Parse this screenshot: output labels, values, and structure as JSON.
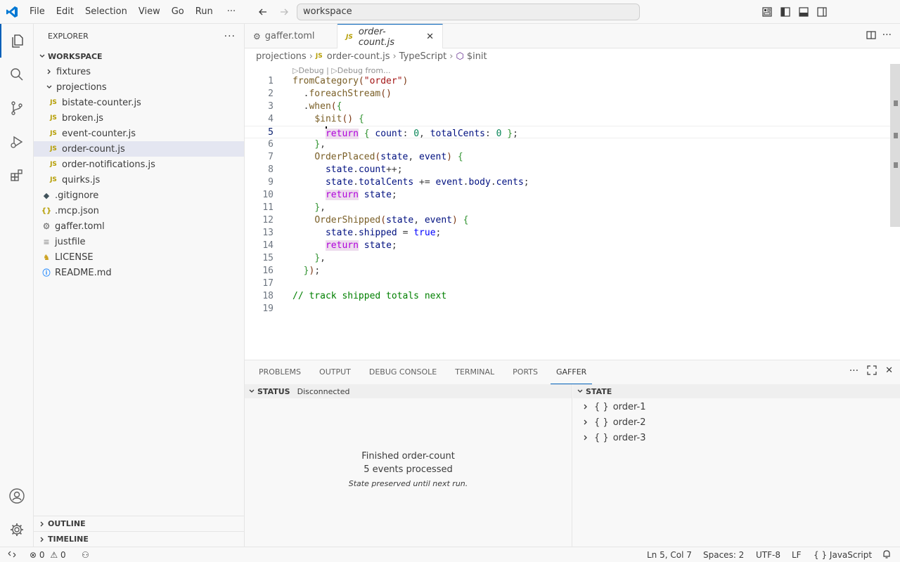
{
  "menu": [
    "File",
    "Edit",
    "Selection",
    "View",
    "Go",
    "Run",
    "···"
  ],
  "command_center": "workspace",
  "sidebar": {
    "title": "EXPLORER",
    "root": "WORKSPACE",
    "items": [
      {
        "label": "fixtures",
        "type": "folder"
      },
      {
        "label": "projections",
        "type": "folder-open"
      },
      {
        "label": "bistate-counter.js",
        "type": "js"
      },
      {
        "label": "broken.js",
        "type": "js"
      },
      {
        "label": "event-counter.js",
        "type": "js"
      },
      {
        "label": "order-count.js",
        "type": "js"
      },
      {
        "label": "order-notifications.js",
        "type": "js"
      },
      {
        "label": "quirks.js",
        "type": "js"
      },
      {
        "label": ".gitignore",
        "type": "git"
      },
      {
        "label": ".mcp.json",
        "type": "json"
      },
      {
        "label": "gaffer.toml",
        "type": "toml"
      },
      {
        "label": "justfile",
        "type": "text"
      },
      {
        "label": "LICENSE",
        "type": "license"
      },
      {
        "label": "README.md",
        "type": "info"
      }
    ],
    "outline": "OUTLINE",
    "timeline": "TIMELINE"
  },
  "tabs": [
    {
      "label": "gaffer.toml",
      "active": false
    },
    {
      "label": "order-count.js",
      "active": true
    }
  ],
  "breadcrumb": [
    "projections",
    "order-count.js",
    "TypeScript",
    "$init"
  ],
  "editor": {
    "codelens": "▷Debug | ▷Debug from...",
    "current_line": 5,
    "lines": [
      "fromCategory(\"order\")",
      "  .foreachStream()",
      "  .when({",
      "    $init() {",
      "      return { count: 0, totalCents: 0 };",
      "    },",
      "    OrderPlaced(state, event) {",
      "      state.count++;",
      "      state.totalCents += event.body.cents;",
      "      return state;",
      "    },",
      "    OrderShipped(state, event) {",
      "      state.shipped = true;",
      "      return state;",
      "    },",
      "  });",
      "",
      "// track shipped totals next",
      ""
    ]
  },
  "panel": {
    "tabs": [
      "PROBLEMS",
      "OUTPUT",
      "DEBUG CONSOLE",
      "TERMINAL",
      "PORTS",
      "GAFFER"
    ],
    "active_tab": "GAFFER",
    "status_title": "STATUS",
    "status_value": "Disconnected",
    "finished": "Finished order-count",
    "events": "5 events processed",
    "preserved": "State preserved until next run.",
    "state_title": "STATE",
    "state_items": [
      "order-1",
      "order-2",
      "order-3"
    ]
  },
  "statusbar": {
    "errors": "0",
    "warnings": "0",
    "position": "Ln 5, Col 7",
    "spaces": "Spaces: 2",
    "encoding": "UTF-8",
    "eol": "LF",
    "language": "JavaScript"
  },
  "colors": {
    "accent": "#005fb8",
    "keyword": "#af00db",
    "function": "#795e26",
    "string": "#a31515",
    "number": "#098658",
    "comment": "#008000"
  }
}
